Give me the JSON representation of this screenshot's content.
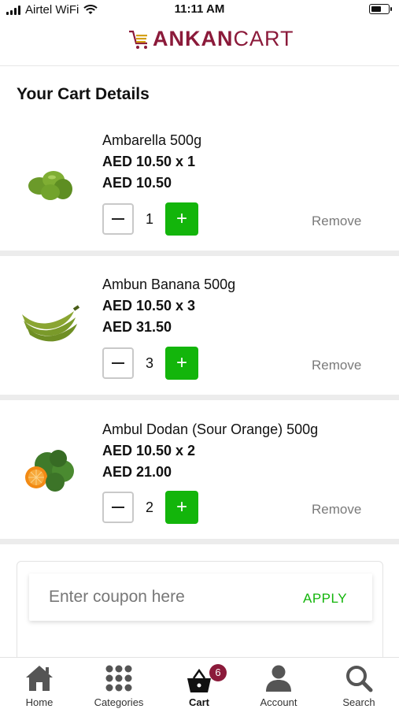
{
  "status_bar": {
    "carrier": "Airtel WiFi",
    "time": "11:11 AM"
  },
  "header": {
    "logo_part1": "ANKAN",
    "logo_part2": "CART"
  },
  "page": {
    "title": "Your Cart Details"
  },
  "cart_items": [
    {
      "name": "Ambarella 500g",
      "unit_line": "AED 10.50 x 1",
      "total": "AED 10.50",
      "quantity": "1",
      "remove_label": "Remove",
      "image": "ambarella-image"
    },
    {
      "name": "Ambun Banana 500g",
      "unit_line": "AED 10.50 x 3",
      "total": "AED 31.50",
      "quantity": "3",
      "remove_label": "Remove",
      "image": "banana-image"
    },
    {
      "name": "Ambul Dodan (Sour Orange) 500g",
      "unit_line": "AED 10.50 x 2",
      "total": "AED 21.00",
      "quantity": "2",
      "remove_label": "Remove",
      "image": "sour-orange-image"
    }
  ],
  "coupon": {
    "placeholder": "Enter coupon here",
    "apply_label": "APPLY"
  },
  "bottom_nav": {
    "items": [
      {
        "label": "Home",
        "icon": "home-icon"
      },
      {
        "label": "Categories",
        "icon": "grid-icon"
      },
      {
        "label": "Cart",
        "icon": "cart-basket-icon",
        "badge": "6",
        "active": true
      },
      {
        "label": "Account",
        "icon": "user-icon"
      },
      {
        "label": "Search",
        "icon": "search-icon"
      }
    ]
  },
  "colors": {
    "brand": "#8b1a3a",
    "accent_green": "#13b50b"
  }
}
